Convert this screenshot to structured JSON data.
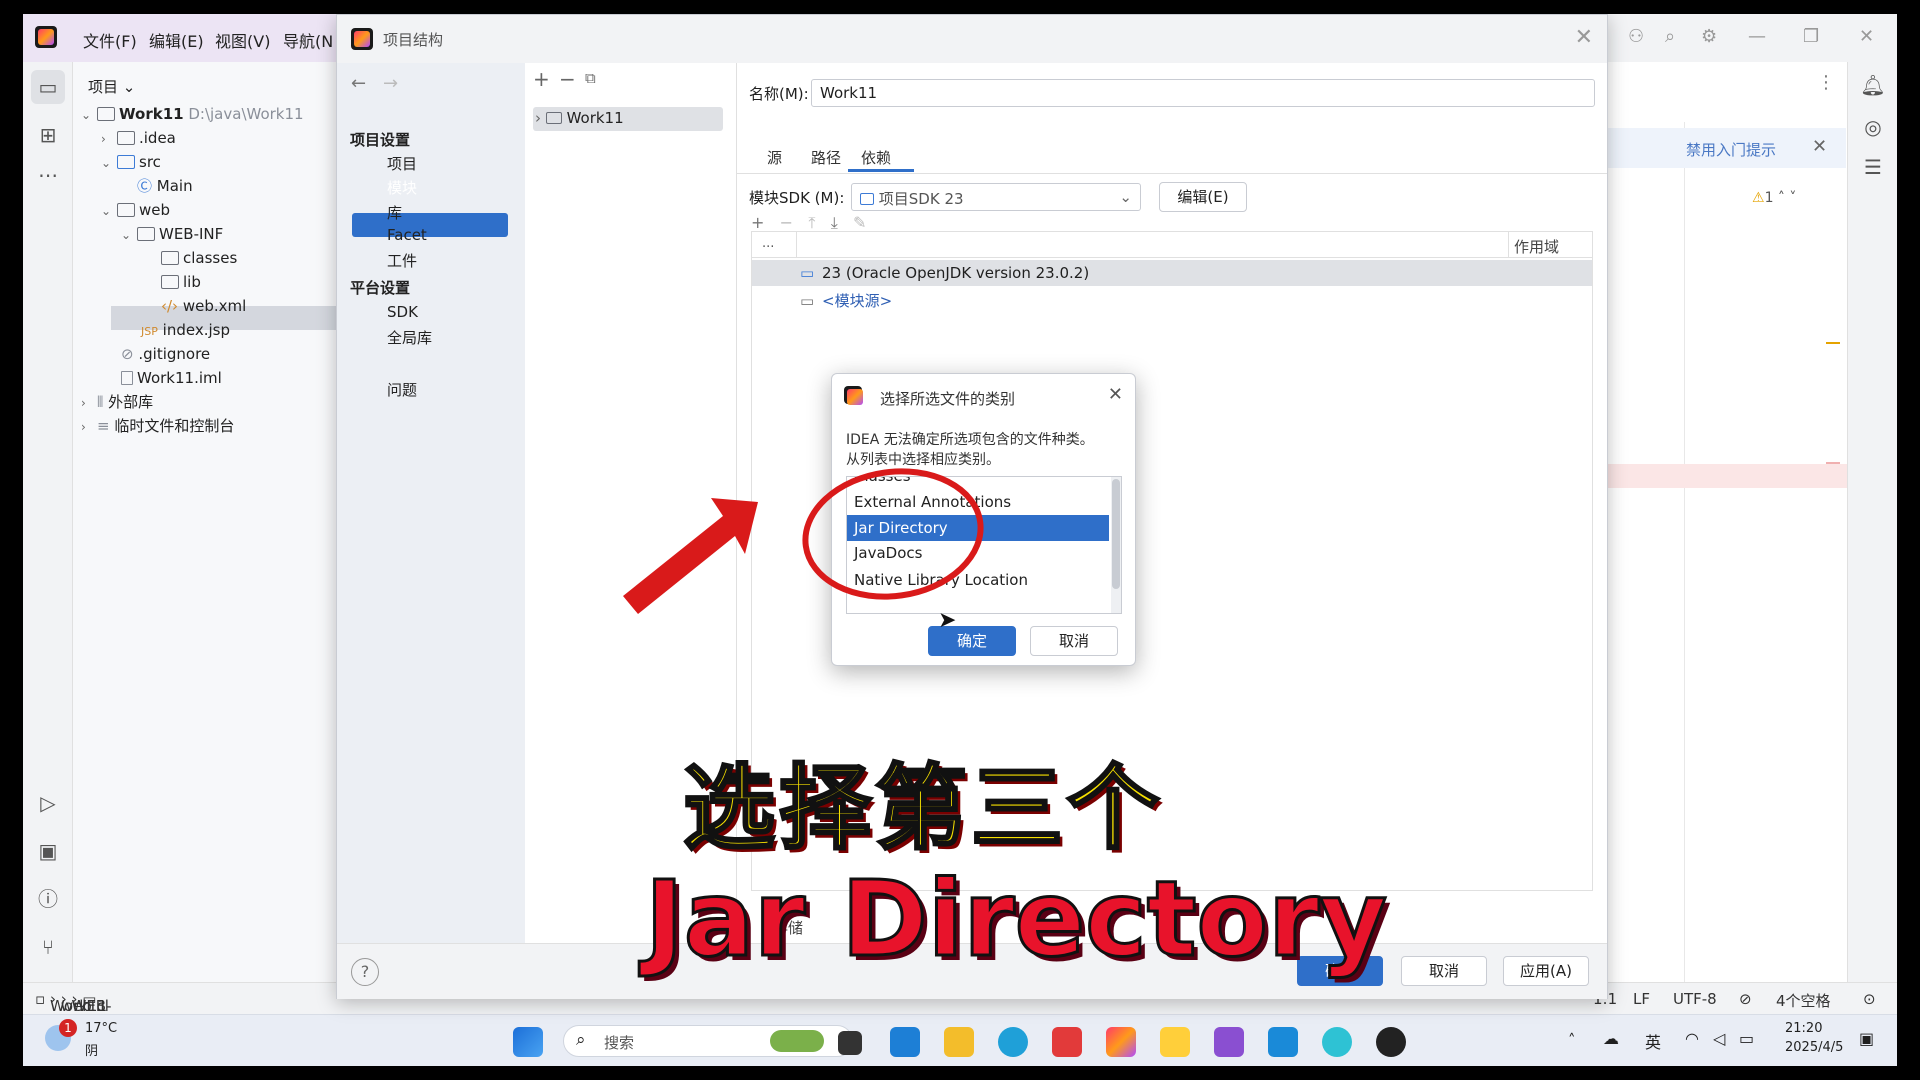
{
  "ide": {
    "menu": [
      "文件(F)",
      "编辑(E)",
      "视图(V)",
      "导航(N"
    ],
    "project_label": "项目",
    "hint_text": "禁用入门提示",
    "warning_count": "1",
    "tree": [
      {
        "label": "Work11",
        "extra": "D:\\java\\Work11"
      },
      {
        "label": ".idea"
      },
      {
        "label": "src"
      },
      {
        "label": "Main"
      },
      {
        "label": "web"
      },
      {
        "label": "WEB-INF"
      },
      {
        "label": "classes"
      },
      {
        "label": "lib"
      },
      {
        "label": "web.xml"
      },
      {
        "label": "index.jsp"
      },
      {
        "label": ".gitignore"
      },
      {
        "label": "Work11.iml"
      },
      {
        "label": "外部库"
      },
      {
        "label": "临时文件和控制台"
      }
    ]
  },
  "statusbar": {
    "breadcrumb": [
      "Work11",
      "web",
      "WEB-INF",
      "cl"
    ],
    "position": "1:1",
    "line_ending": "LF",
    "encoding": "UTF-8",
    "indent": "4个空格"
  },
  "project_structure": {
    "title": "项目结构",
    "nav": {
      "project_settings": "项目设置",
      "project_items": [
        "项目",
        "模块",
        "库",
        "Facet",
        "工件"
      ],
      "platform_settings": "平台设置",
      "platform_items": [
        "SDK",
        "全局库"
      ],
      "problems": "问题"
    },
    "module": "Work11",
    "name_label": "名称(M):",
    "name_value": "Work11",
    "tabs": [
      "源",
      "路径",
      "依赖"
    ],
    "sdk_label": "模块SDK (M):",
    "sdk_value": "项目SDK 23",
    "edit_button": "编辑(E)",
    "scope_header": "作用域",
    "ellipsis": "...",
    "dependencies": [
      "23 (Oracle OpenJDK version 23.0.2)",
      "<模块源>"
    ],
    "storage_prefix": "存储",
    "ok": "确定",
    "cancel": "取消",
    "apply": "应用(A)"
  },
  "choose_dialog": {
    "title": "选择所选文件的类别",
    "message_line1": "IDEA 无法确定所选项包含的文件种类。",
    "message_line2": "从列表中选择相应类别。",
    "options": [
      "Classes",
      "External Annotations",
      "Jar Directory",
      "JavaDocs",
      "Native Library Location"
    ],
    "selected_index": 2,
    "ok": "确定",
    "cancel": "取消"
  },
  "taskbar": {
    "weather_temp": "17°C",
    "weather_desc": "阴",
    "weather_badge": "1",
    "search": "搜索",
    "ime": "英",
    "time": "21:20",
    "date": "2025/4/5"
  },
  "captions": {
    "line1": "选择第三个",
    "line2": "Jar Directory"
  },
  "colors": {
    "accent": "#2f6fc9",
    "caption_yellow": "#f7e100",
    "caption_red": "#e8132b",
    "annotation_red": "#d91a1a"
  }
}
